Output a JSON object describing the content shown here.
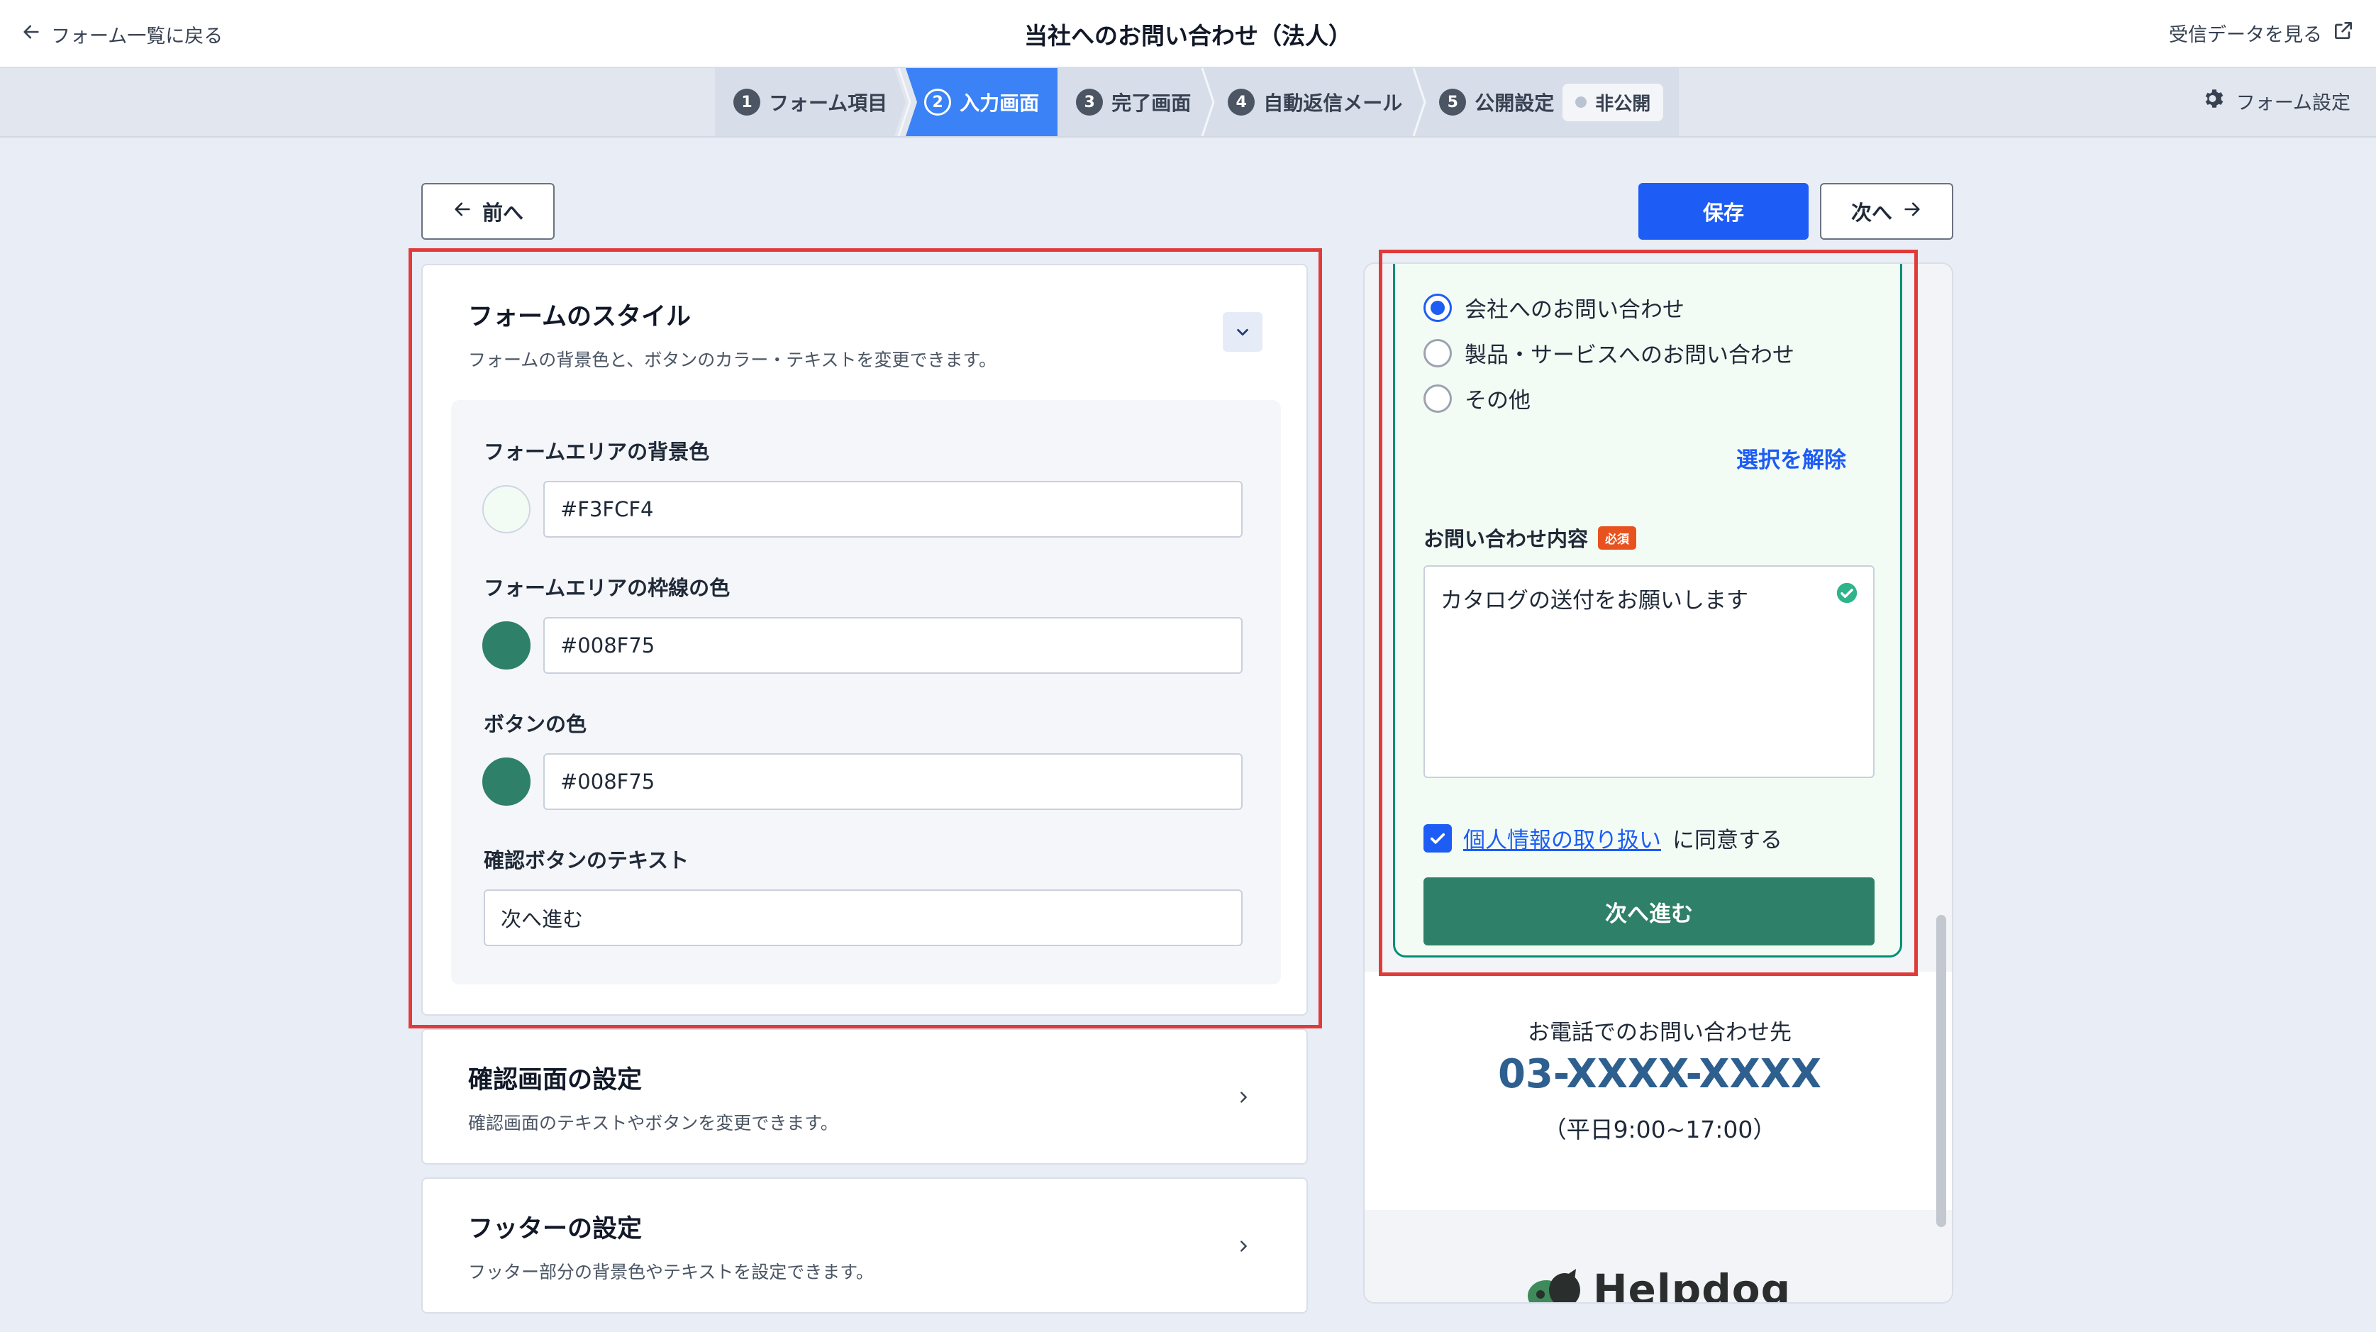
{
  "header": {
    "back_label": "フォーム一覧に戻る",
    "title": "当社へのお問い合わせ（法人）",
    "view_data_label": "受信データを見る"
  },
  "steps": [
    {
      "num": "1",
      "label": "フォーム項目"
    },
    {
      "num": "2",
      "label": "入力画面"
    },
    {
      "num": "3",
      "label": "完了画面"
    },
    {
      "num": "4",
      "label": "自動返信メール"
    },
    {
      "num": "5",
      "label": "公開設定"
    }
  ],
  "publish_status": "非公開",
  "form_settings_label": "フォーム設定",
  "actions": {
    "prev_label": "前へ",
    "save_label": "保存",
    "next_label": "次へ"
  },
  "style_card": {
    "title": "フォームのスタイル",
    "desc": "フォームの背景色と、ボタンのカラー・テキストを変更できます。",
    "fields": {
      "bg_label": "フォームエリアの背景色",
      "bg_value": "#F3FCF4",
      "border_label": "フォームエリアの枠線の色",
      "border_value": "#008F75",
      "button_label": "ボタンの色",
      "button_value": "#008F75",
      "confirm_label": "確認ボタンのテキスト",
      "confirm_value": "次へ進む"
    }
  },
  "confirm_card": {
    "title": "確認画面の設定",
    "desc": "確認画面のテキストやボタンを変更できます。"
  },
  "footer_card": {
    "title": "フッターの設定",
    "desc": "フッター部分の背景色やテキストを設定できます。"
  },
  "preview": {
    "radio_options": [
      "会社へのお問い合わせ",
      "製品・サービスへのお問い合わせ",
      "その他"
    ],
    "clear_selection": "選択を解除",
    "question_label": "お問い合わせ内容",
    "required_badge": "必須",
    "textarea_value": "カタログの送付をお願いします",
    "privacy_link": "個人情報の取り扱い",
    "agree_suffix": "に同意する",
    "submit_label": "次へ進む",
    "contact_title": "お電話でのお問い合わせ先",
    "contact_phone": "03-XXXX-XXXX",
    "contact_hours": "（平日9:00~17:00）",
    "brand_name": "Helpdog"
  },
  "colors": {
    "accent_blue": "#1d5cf5",
    "form_bg": "#F3FCF4",
    "form_border": "#008F75",
    "button": "#2f8068",
    "highlight_red": "#e03b3b"
  }
}
